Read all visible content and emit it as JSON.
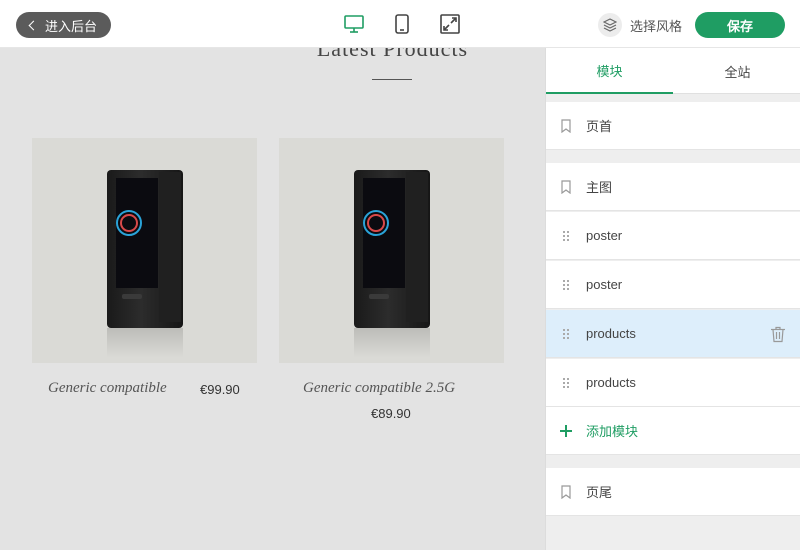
{
  "topbar": {
    "back_label": "进入后台",
    "style_label": "选择风格",
    "save_label": "保存",
    "devices": [
      "desktop-icon",
      "mobile-icon",
      "fullscreen-icon"
    ],
    "accent": "#1f9d63"
  },
  "preview": {
    "section_title": "Latest Products",
    "products": [
      {
        "name": "Generic compatible",
        "price": "€99.90"
      },
      {
        "name": "Generic compatible 2.5G",
        "price": "€89.90"
      }
    ]
  },
  "panel": {
    "tabs": [
      {
        "label": "模块",
        "active": true
      },
      {
        "label": "全站",
        "active": false
      }
    ],
    "header_row": "页首",
    "modules": [
      {
        "label": "主图",
        "icon": "bookmark-icon"
      },
      {
        "label": "poster",
        "icon": "drag-handle-icon"
      },
      {
        "label": "poster",
        "icon": "drag-handle-icon"
      },
      {
        "label": "products",
        "icon": "drag-handle-icon",
        "active": true
      },
      {
        "label": "products",
        "icon": "drag-handle-icon"
      }
    ],
    "add_label": "添加模块",
    "footer_row": "页尾"
  }
}
